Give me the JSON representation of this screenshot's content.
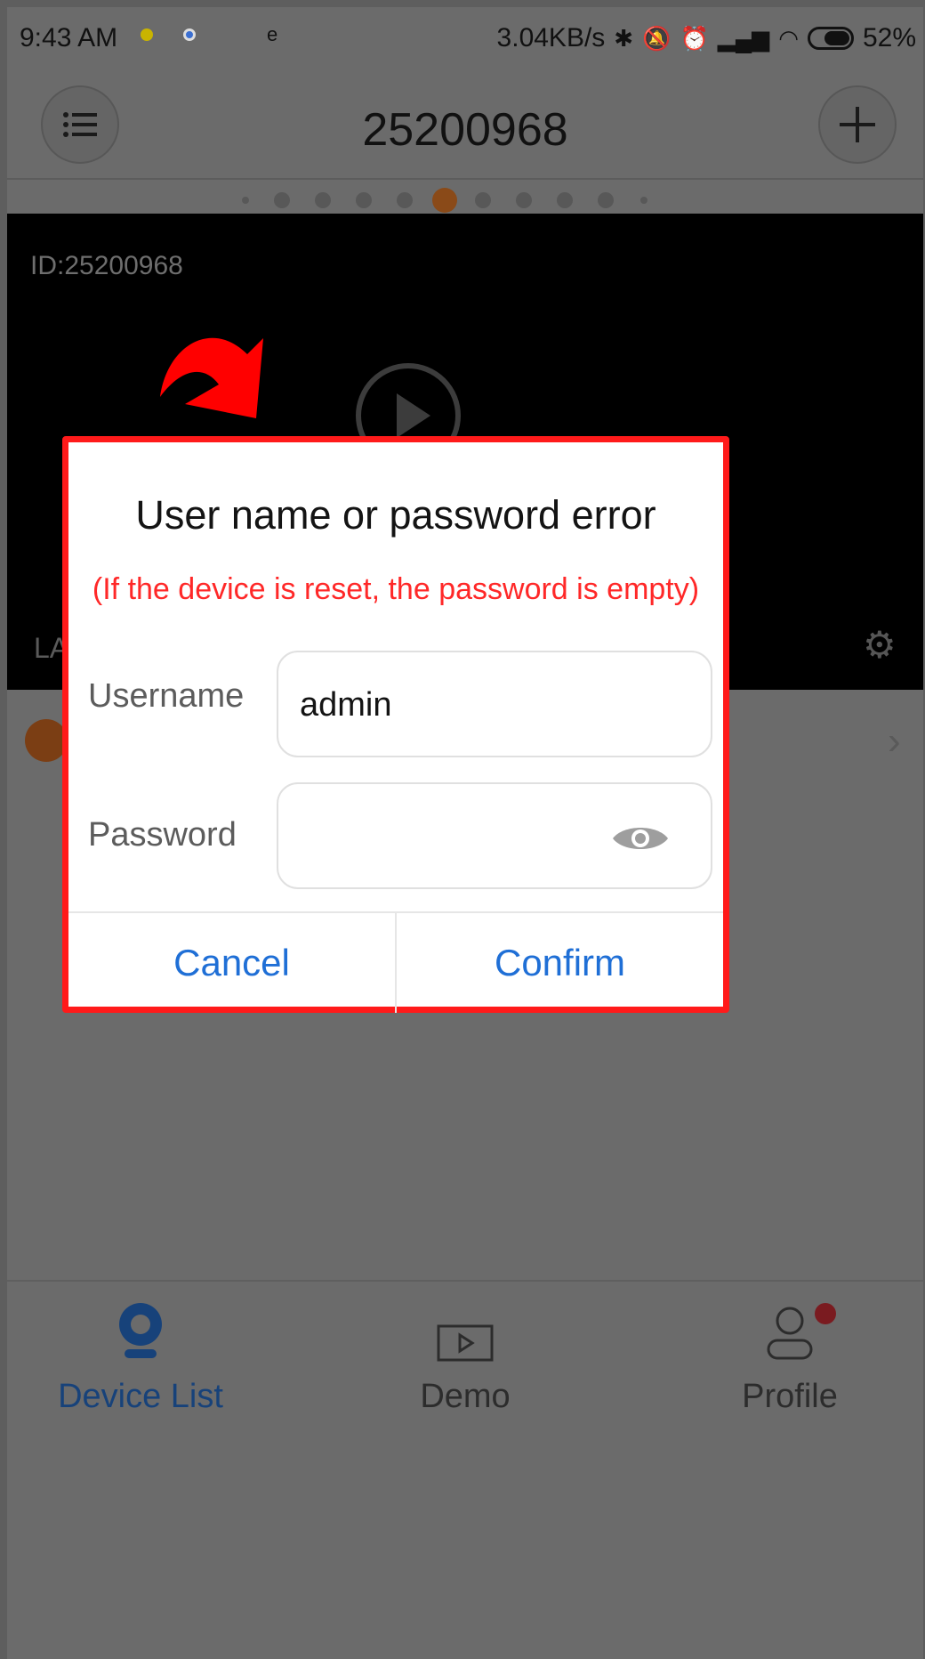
{
  "status_bar": {
    "time": "9:43 AM",
    "e_label": "e",
    "speed": "3.04KB/s",
    "battery": "52%"
  },
  "header": {
    "title": "25200968"
  },
  "pager": {
    "count": 11,
    "active_index": 5
  },
  "video": {
    "device_id": "ID:25200968",
    "partial_label": "LA"
  },
  "dialog": {
    "title": "User name or password error",
    "note": "(If the device is reset, the password is empty)",
    "username_label": "Username",
    "username_value": "admin",
    "password_label": "Password",
    "password_value": "",
    "cancel_label": "Cancel",
    "confirm_label": "Confirm"
  },
  "bottom_nav": {
    "device_list": "Device List",
    "demo": "Demo",
    "profile": "Profile"
  },
  "colors": {
    "accent_blue": "#1f6fd6",
    "error_red": "#ff2828",
    "highlight_border": "#ff1a1a",
    "active_dot": "#8a4a18"
  }
}
